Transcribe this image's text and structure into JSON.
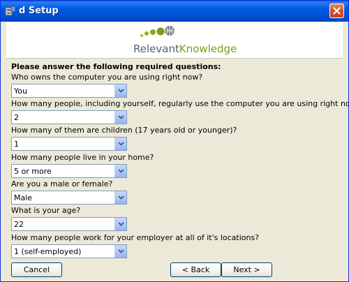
{
  "window": {
    "title": "d Setup"
  },
  "banner": {
    "logo_text_1": "Relevant",
    "logo_text_2": "Knowledge"
  },
  "form": {
    "heading": "Please answer the following required questions:",
    "questions": [
      {
        "label": "Who owns the computer you are using right now?",
        "value": "You"
      },
      {
        "label": "How many people, including yourself, regularly use the computer you are using right now?",
        "value": "2"
      },
      {
        "label": "How many of them are children (17 years old or younger)?",
        "value": "1"
      },
      {
        "label": "How many people live in your home?",
        "value": "5 or more"
      },
      {
        "label": "Are you a male or female?",
        "value": "Male"
      },
      {
        "label": "What is your age?",
        "value": "22"
      },
      {
        "label": "How many people work for your employer at all of it's locations?",
        "value": "1 (self-employed)"
      }
    ]
  },
  "buttons": {
    "cancel": "Cancel",
    "back": "< Back",
    "next": "Next >"
  },
  "icons": {
    "title": "setup-icon",
    "close": "close-icon",
    "dropdown": "chevron-down-icon"
  },
  "colors": {
    "titlebar": "#0058e6",
    "window_bg": "#ece9d8",
    "logo_green": "#7a9d1a",
    "logo_gray": "#5a6066"
  }
}
